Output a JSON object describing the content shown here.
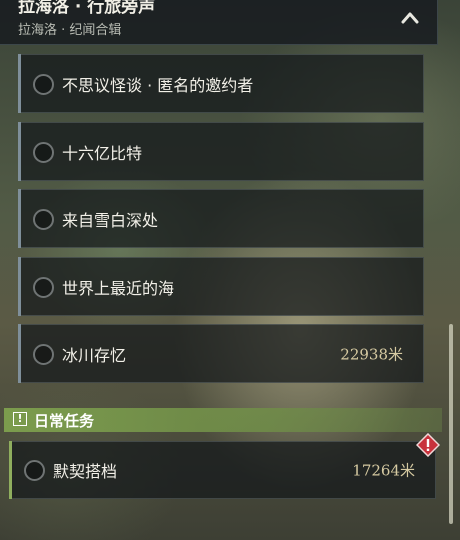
{
  "header": {
    "title": "拉海洛 · 行旅旁声",
    "subtitle": "拉海洛 · 纪闻合辑"
  },
  "quests": [
    {
      "name": "不思议怪谈 · 匿名的邀约者",
      "distance": ""
    },
    {
      "name": "十六亿比特",
      "distance": ""
    },
    {
      "name": "来自雪白深处",
      "distance": ""
    },
    {
      "name": "世界上最近的海",
      "distance": ""
    },
    {
      "name": "冰川存忆",
      "distance": "22938米"
    }
  ],
  "daily": {
    "section_label": "日常任务",
    "quest": {
      "name": "默契搭档",
      "distance": "17264米"
    }
  },
  "colors": {
    "daily_accent": "#7ea04e",
    "warning": "#c8323c",
    "distance_text": "#d6caa2"
  },
  "icons": {
    "collapse": "chevron-up-icon",
    "daily": "exclamation-box-icon",
    "warning": "warning-diamond-icon"
  }
}
